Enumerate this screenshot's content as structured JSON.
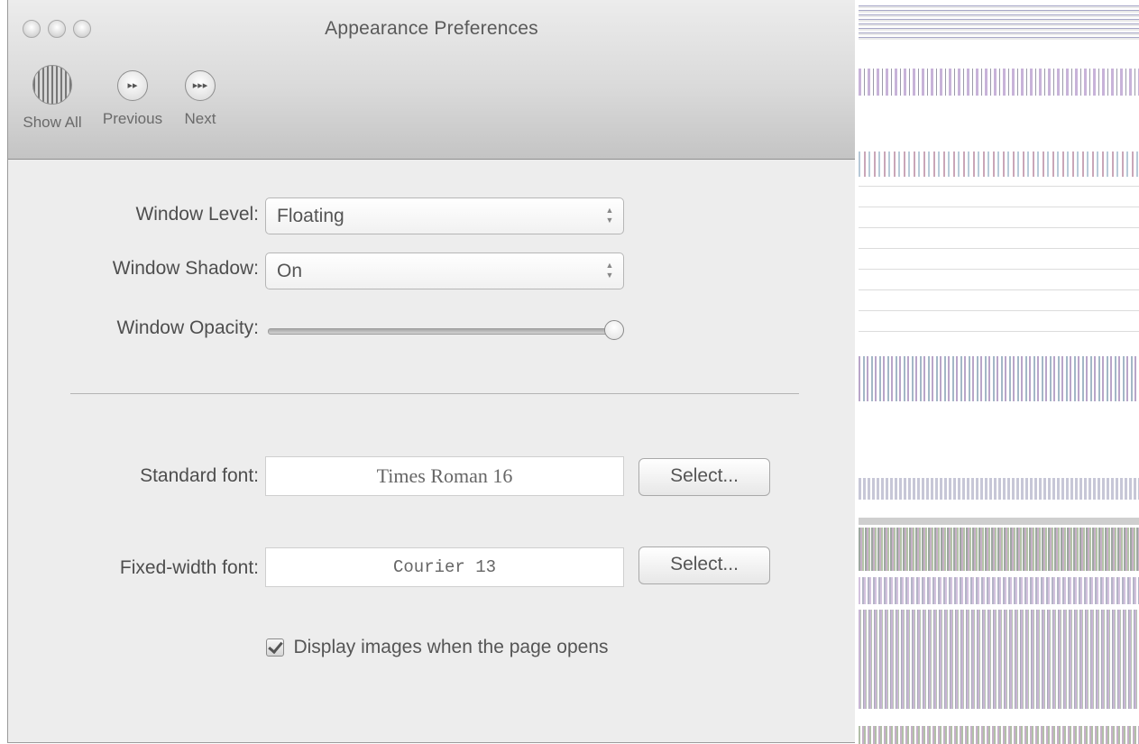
{
  "window": {
    "title": "Appearance Preferences"
  },
  "toolbar": {
    "items": [
      {
        "label": "Show All",
        "icon": "show-all-icon"
      },
      {
        "label": "Previous",
        "icon": "previous-icon"
      },
      {
        "label": "Next",
        "icon": "next-icon"
      }
    ]
  },
  "form": {
    "window_level": {
      "label": "Window Level:",
      "value": "Floating"
    },
    "window_shadow": {
      "label": "Window Shadow:",
      "value": "On"
    },
    "window_opacity": {
      "label": "Window Opacity:",
      "value_fraction": 1.0
    },
    "standard_font": {
      "label": "Standard font:",
      "value": "Times Roman 16",
      "button": "Select..."
    },
    "fixed_font": {
      "label": "Fixed-width font:",
      "value": "Courier 13",
      "button": "Select..."
    },
    "display_images": {
      "label": "Display images when the page opens",
      "checked": true
    }
  },
  "colors": {
    "window_bg": "#ededed",
    "title_text": "#5a5a5a",
    "label_text": "#4e4e4e"
  }
}
